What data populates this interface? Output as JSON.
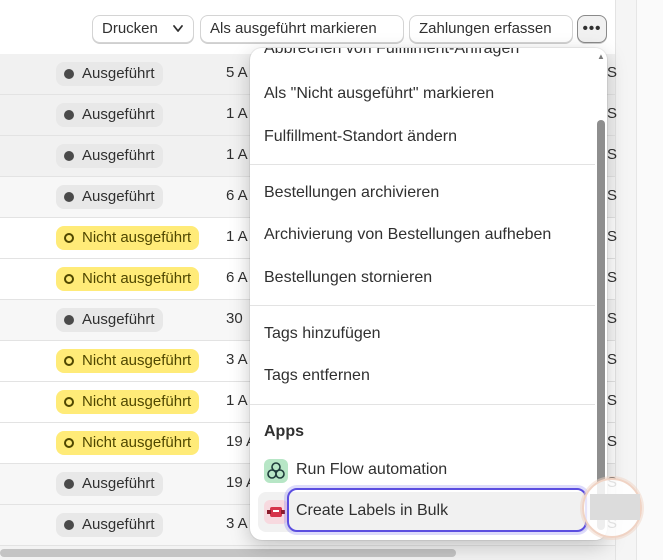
{
  "toolbar": {
    "print_label": "Drucken",
    "mark_fulfilled_label": "Als ausgeführt markieren",
    "capture_payments_label": "Zahlungen erfassen",
    "more_label": "•••"
  },
  "rows": [
    {
      "status": "Ausgeführt",
      "status_kind": "fulfilled",
      "date": "5 A",
      "trail": "S",
      "bg": "gray"
    },
    {
      "status": "Ausgeführt",
      "status_kind": "fulfilled",
      "date": "1 A",
      "trail": "S",
      "bg": "gray"
    },
    {
      "status": "Ausgeführt",
      "status_kind": "fulfilled",
      "date": "1 A",
      "trail": "S",
      "bg": "gray"
    },
    {
      "status": "Ausgeführt",
      "status_kind": "fulfilled",
      "date": "6 A",
      "trail": "S",
      "bg": "light"
    },
    {
      "status": "Nicht ausgeführt",
      "status_kind": "unfulfilled",
      "date": "1 A",
      "trail": "S",
      "bg": "white"
    },
    {
      "status": "Nicht ausgeführt",
      "status_kind": "unfulfilled",
      "date": "6 A",
      "trail": "S",
      "bg": "white"
    },
    {
      "status": "Ausgeführt",
      "status_kind": "fulfilled",
      "date": "30",
      "trail": "S",
      "bg": "light"
    },
    {
      "status": "Nicht ausgeführt",
      "status_kind": "unfulfilled",
      "date": "3 A",
      "trail": "S",
      "bg": "white"
    },
    {
      "status": "Nicht ausgeführt",
      "status_kind": "unfulfilled",
      "date": "1 A",
      "trail": "S",
      "bg": "white"
    },
    {
      "status": "Nicht ausgeführt",
      "status_kind": "unfulfilled",
      "date": "19 A",
      "trail": "S",
      "bg": "white"
    },
    {
      "status": "Ausgeführt",
      "status_kind": "fulfilled",
      "date": "19 A",
      "trail": "S",
      "bg": "light"
    },
    {
      "status": "Ausgeführt",
      "status_kind": "fulfilled",
      "date": "3 A",
      "trail": "S",
      "bg": "light"
    }
  ],
  "menu": {
    "item_cancel_fulfillment": "Abbrechen von Fulfillment-Anfragen",
    "item_mark_unfulfilled": "Als \"Nicht ausgeführt\" markieren",
    "item_change_location": "Fulfillment-Standort ändern",
    "item_archive": "Bestellungen archivieren",
    "item_unarchive": "Archivierung von Bestellungen aufheben",
    "item_cancel_orders": "Bestellungen stornieren",
    "item_add_tags": "Tags hinzufügen",
    "item_remove_tags": "Tags entfernen",
    "apps_title": "Apps",
    "app_flow": "Run Flow automation",
    "app_labels": "Create Labels in Bulk"
  },
  "colors": {
    "badge_fulfilled": "#e8e8e8",
    "badge_unfulfilled": "#ffeb78",
    "focus_ring": "#5b4ee0"
  }
}
